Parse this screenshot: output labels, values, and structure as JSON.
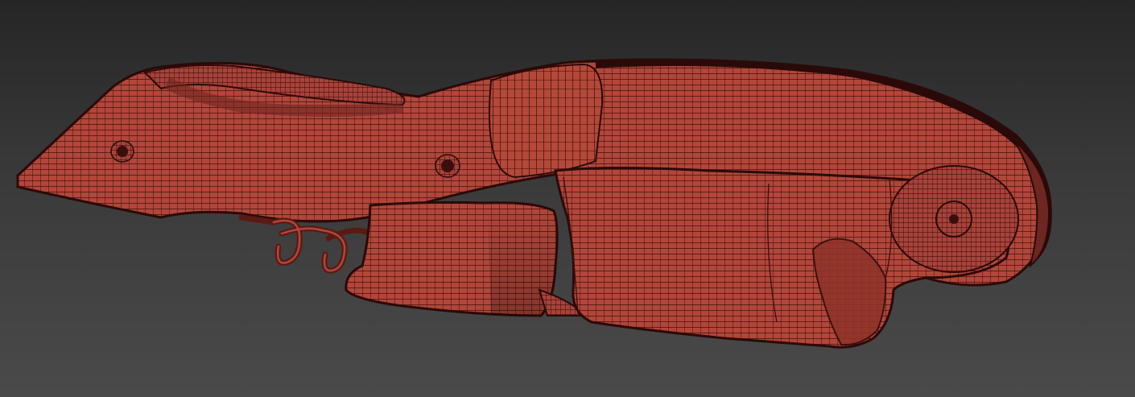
{
  "viewport": {
    "background_top": "#262626",
    "background_bottom": "#4a4a4a"
  },
  "model": {
    "object_type": "corkscrew-wireframe-mesh",
    "display_mode": "shaded-with-edged-faces",
    "fill_color": "#b2463a",
    "fill_color_dark": "#8e3329",
    "wire_color": "#3a0e0b"
  }
}
